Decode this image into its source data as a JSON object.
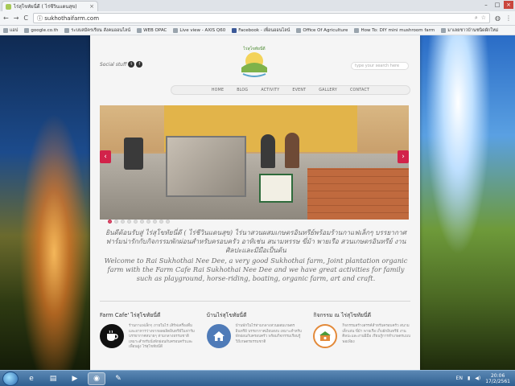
{
  "browser": {
    "tab_title": "ไร่สุโขทัยนี่ดี ( ไร่ชีวินแดนสุข)",
    "tab_close": "×",
    "window_controls": [
      "–",
      "□",
      "×"
    ],
    "url": "sukhothaifarm.com",
    "bookmarks": [
      "แอป",
      "google.co.th",
      "ระบบสมัครเรียน สังคมออนไลน์",
      "WEB OPAC",
      "Live view - AXIS Q60",
      "Facebook - เพื่อนออนไลน์",
      "Office Of Agriculture",
      "How To: DIY mini mushroom farm",
      "มาเลยชาวบ้านชนิดผักใหม่"
    ]
  },
  "site": {
    "social_label": "Social stuff",
    "social_icons": [
      "twitter-icon",
      "facebook-icon"
    ],
    "logo_text": "ไร่สุโขทัยนี่ดี",
    "search_placeholder": "type your search here",
    "menu": [
      "HOME",
      "BLOG",
      "ACTIVITY",
      "EVENT",
      "GALLERY",
      "CONTACT"
    ],
    "slider_prev": "‹",
    "slider_next": "›",
    "slide_dot_count": 10,
    "intro_thai": "ยินดีต้อนรับสู่ ไร่สุโขทัยนี่ดี ( ไร่ชีวินแดนสุข) ไร่นาสวนผสมเกษตรอินทรีย์พร้อมร้านกาแฟเล็กๆ บรรยากาศฟาร์มน่ารักกับกิจกรรมพักผ่อนสำหรับครอบครัว อาทิเช่น สนามหรรษ ขี่ม้า พายเรือ สวนเกษตรอินทรีย์ งานศิลปะและมีมือเป็นต้น",
    "intro_en": "Welcome to Rai Sukhothai Nee Dee, a very good Sukhothai farm, Joint plantation organic farm with the Farm Cafe Rai Sukhothai Nee Dee and we have great activities for family such as playground, horse-riding, boating, organic farm, art and craft.",
    "columns": [
      {
        "title": "Farm Cafe' ไร่สุโขทัยนี่ดี",
        "icon": "coffee-cup-icon",
        "text": "ร้านกาแฟเล็กๆ ภายในไร่ เสิร์ฟเครื่องดื่มและอาหารว่างจากผลผลิตอินทรีย์ในฟาร์ม บรรยากาศสบายๆ ท่ามกลางธรรมชาติ เหมาะสำหรับนั่งพักผ่อนกับครอบครัวและเพื่อนฝูง ไร่สุโขทัยนี่ดี"
      },
      {
        "title": "บ้านไร่สุโขทัยนี่ดี",
        "icon": "home-icon",
        "text": "บ้านพักในไร่ท่ามกลางสวนผสมเกษตรอินทรีย์ บรรยากาศเงียบสงบ เหมาะสำหรับพักผ่อนกับครอบครัว พร้อมกิจกรรมเรียนรู้วิถีเกษตรธรรมชาติ"
      },
      {
        "title": "กิจกรรม ณ ไร่สุโขทัยนี่ดี",
        "icon": "activity-icon",
        "text": "กิจกรรมสร้างสรรค์สำหรับครอบครัว สนามเด็กเล่น ขี่ม้า พายเรือ เก็บผักอินทรีย์ งานศิลปะและงานฝีมือ เรียนรู้การทำเกษตรแบบพอเพียง"
      }
    ]
  },
  "taskbar": {
    "apps": [
      "windows-explorer-icon",
      "file-folder-icon",
      "media-player-icon",
      "chrome-icon",
      "paint-icon"
    ],
    "lang": "EN",
    "time": "20:06",
    "date": "17/2/2561"
  },
  "colors": {
    "accent": "#d2234a",
    "menu_text": "#666666"
  }
}
